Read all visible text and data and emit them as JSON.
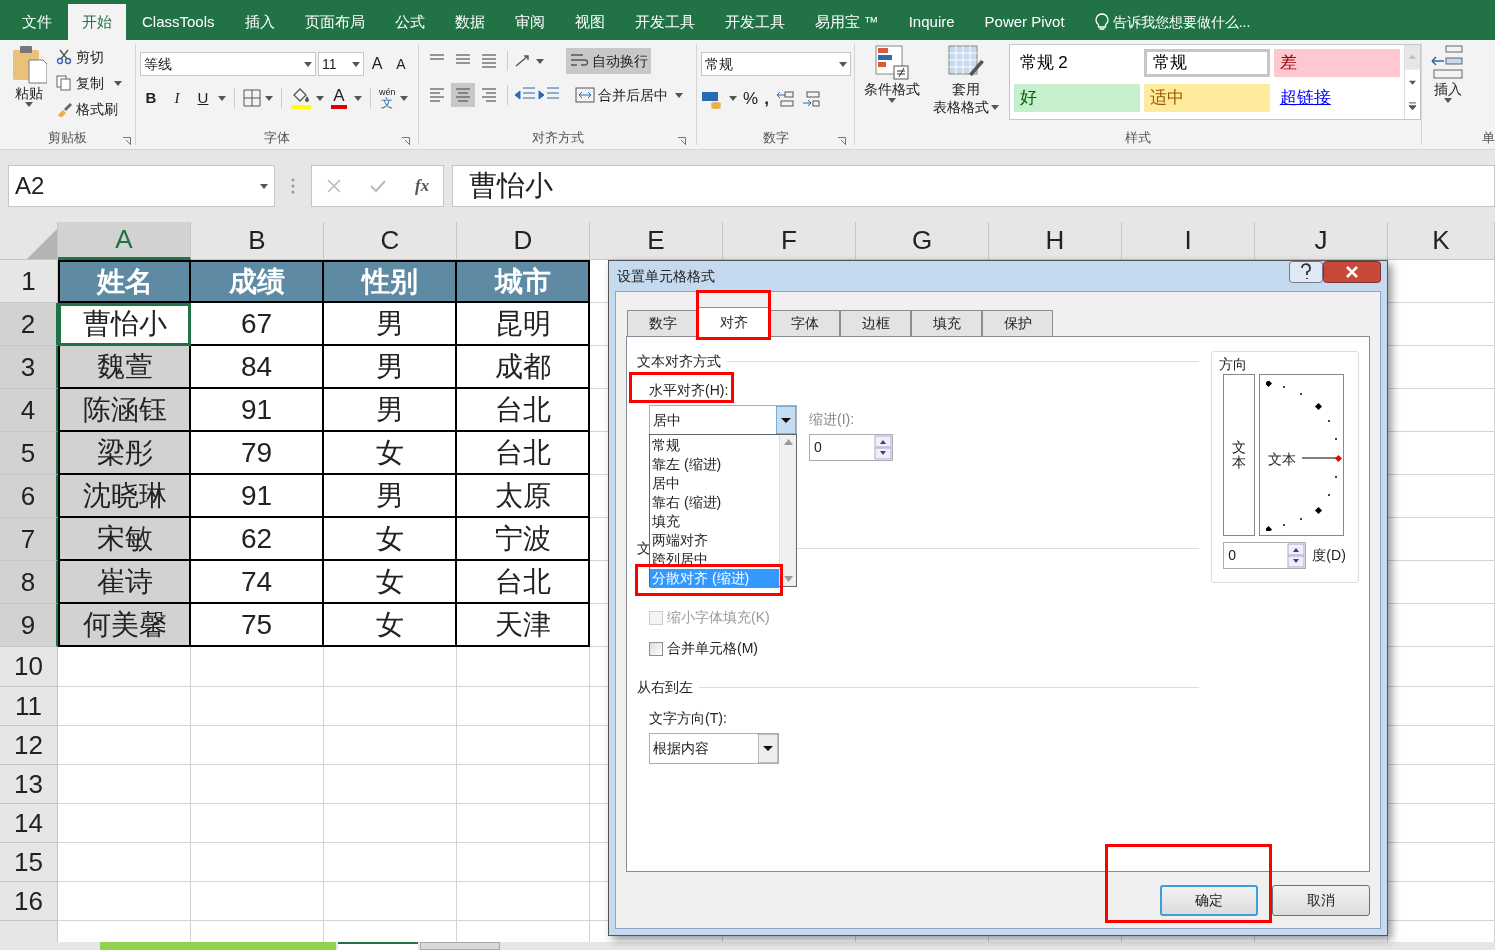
{
  "menu_tabs": [
    {
      "label": "文件",
      "selected": false
    },
    {
      "label": "开始",
      "selected": true
    },
    {
      "label": "ClassTools",
      "selected": false
    },
    {
      "label": "插入",
      "selected": false
    },
    {
      "label": "页面布局",
      "selected": false
    },
    {
      "label": "公式",
      "selected": false
    },
    {
      "label": "数据",
      "selected": false
    },
    {
      "label": "审阅",
      "selected": false
    },
    {
      "label": "视图",
      "selected": false
    },
    {
      "label": "开发工具",
      "selected": false
    },
    {
      "label": "开发工具",
      "selected": false
    },
    {
      "label": "易用宝 ™",
      "selected": false
    },
    {
      "label": "Inquire",
      "selected": false
    },
    {
      "label": "Power Pivot",
      "selected": false
    }
  ],
  "tell_me": "告诉我您想要做什么...",
  "ribbon": {
    "clipboard": {
      "paste": "粘贴",
      "cut": "剪切",
      "copy": "复制",
      "format_painter": "格式刷",
      "title": "剪贴板"
    },
    "font": {
      "name": "等线",
      "size": "11",
      "grow": "A",
      "shrink": "A",
      "bold": "B",
      "italic": "I",
      "underline": "U",
      "font_color": "A",
      "phonetic_hint": "wén",
      "phonetic": "文",
      "title": "字体"
    },
    "alignment": {
      "wrap": "自动换行",
      "merge": "合并后居中",
      "title": "对齐方式"
    },
    "number": {
      "format": "常规",
      "percent": "%",
      "comma": ",",
      "title": "数字"
    },
    "styles": {
      "conditional": "条件格式",
      "table_format_1": "套用",
      "table_format_2": "表格格式",
      "title": "样式",
      "gallery": [
        {
          "label": "常规 2",
          "kind": "plain"
        },
        {
          "label": "常规",
          "kind": "outlined"
        },
        {
          "label": "差",
          "kind": "bad"
        },
        {
          "label": "好",
          "kind": "good"
        },
        {
          "label": "适中",
          "kind": "neutral"
        },
        {
          "label": "超链接",
          "kind": "link"
        }
      ]
    },
    "cells": {
      "insert": "插入",
      "title": "单"
    }
  },
  "name_box": "A2",
  "fx_label": "fx",
  "formula": "曹怡小",
  "columns": [
    {
      "label": "A",
      "selected": true
    },
    {
      "label": "B",
      "selected": false
    },
    {
      "label": "C",
      "selected": false
    },
    {
      "label": "D",
      "selected": false
    },
    {
      "label": "E",
      "selected": false
    },
    {
      "label": "F",
      "selected": false
    },
    {
      "label": "G",
      "selected": false
    },
    {
      "label": "H",
      "selected": false
    },
    {
      "label": "I",
      "selected": false
    },
    {
      "label": "J",
      "selected": false
    },
    {
      "label": "K",
      "selected": false
    }
  ],
  "rows": [
    {
      "number": "1",
      "selected": false,
      "active": false,
      "header": true,
      "cells": [
        "姓名",
        "成绩",
        "性别",
        "城市"
      ]
    },
    {
      "number": "2",
      "selected": true,
      "active": true,
      "header": false,
      "cells": [
        "曹怡小",
        "67",
        "男",
        "昆明"
      ]
    },
    {
      "number": "3",
      "selected": true,
      "active": false,
      "header": false,
      "cells": [
        "魏萱",
        "84",
        "男",
        "成都"
      ]
    },
    {
      "number": "4",
      "selected": true,
      "active": false,
      "header": false,
      "cells": [
        "陈涵钰",
        "91",
        "男",
        "台北"
      ]
    },
    {
      "number": "5",
      "selected": true,
      "active": false,
      "header": false,
      "cells": [
        "梁彤",
        "79",
        "女",
        "台北"
      ]
    },
    {
      "number": "6",
      "selected": true,
      "active": false,
      "header": false,
      "cells": [
        "沈晓琳",
        "91",
        "男",
        "太原"
      ]
    },
    {
      "number": "7",
      "selected": true,
      "active": false,
      "header": false,
      "cells": [
        "宋敏",
        "62",
        "女",
        "宁波"
      ]
    },
    {
      "number": "8",
      "selected": true,
      "active": false,
      "header": false,
      "cells": [
        "崔诗",
        "74",
        "女",
        "台北"
      ]
    },
    {
      "number": "9",
      "selected": true,
      "active": false,
      "header": false,
      "cells": [
        "何美馨",
        "75",
        "女",
        "天津"
      ]
    },
    {
      "number": "10",
      "selected": false
    },
    {
      "number": "11",
      "selected": false
    },
    {
      "number": "12",
      "selected": false
    },
    {
      "number": "13",
      "selected": false
    },
    {
      "number": "14",
      "selected": false
    },
    {
      "number": "15",
      "selected": false
    },
    {
      "number": "16",
      "selected": false
    },
    {
      "selected": false
    }
  ],
  "sheet_tabs": [
    {
      "selected": false
    },
    {
      "selected": true
    },
    {
      "selected": false
    }
  ],
  "dialog": {
    "title": "设置单元格格式",
    "tabs": [
      {
        "label": "数字",
        "selected": false,
        "highlighted": false
      },
      {
        "label": "对齐",
        "selected": true,
        "highlighted": true
      },
      {
        "label": "字体",
        "selected": false,
        "highlighted": false
      },
      {
        "label": "边框",
        "selected": false,
        "highlighted": false
      },
      {
        "label": "填充",
        "selected": false,
        "highlighted": false
      },
      {
        "label": "保护",
        "selected": false,
        "highlighted": false
      }
    ],
    "text_alignment_title": "文本对齐方式",
    "horizontal_label": "水平对齐(H):",
    "horizontal_label_highlighted": true,
    "horizontal_value": "居中",
    "horizontal_options": [
      {
        "label": "常规",
        "selected": false,
        "highlighted": false
      },
      {
        "label": "靠左 (缩进)",
        "selected": false,
        "highlighted": false
      },
      {
        "label": "居中",
        "selected": false,
        "highlighted": false
      },
      {
        "label": "靠右 (缩进)",
        "selected": false,
        "highlighted": false
      },
      {
        "label": "填充",
        "selected": false,
        "highlighted": false
      },
      {
        "label": "两端对齐",
        "selected": false,
        "highlighted": false
      },
      {
        "label": "跨列居中",
        "selected": false,
        "highlighted": false
      },
      {
        "label": "分散对齐 (缩进)",
        "selected": true,
        "highlighted": true
      }
    ],
    "indent_label": "缩进(I):",
    "indent_value": "0",
    "text_control_title": "文",
    "checkboxes": [
      {
        "label": "缩小字体填充(K)",
        "checked": false,
        "disabled": true
      },
      {
        "label": "合并单元格(M)",
        "checked": false,
        "disabled": false
      }
    ],
    "rtl_title": "从右到左",
    "direction_label": "文字方向(T):",
    "direction_value": "根据内容",
    "orientation_title": "方向",
    "vertical_text": "文本",
    "dial_text": "文本",
    "degrees_value": "0",
    "degrees_label": "度(D)",
    "buttons": [
      {
        "label": "确定",
        "default": true,
        "highlighted": true
      },
      {
        "label": "取消",
        "default": false,
        "highlighted": false
      }
    ]
  }
}
